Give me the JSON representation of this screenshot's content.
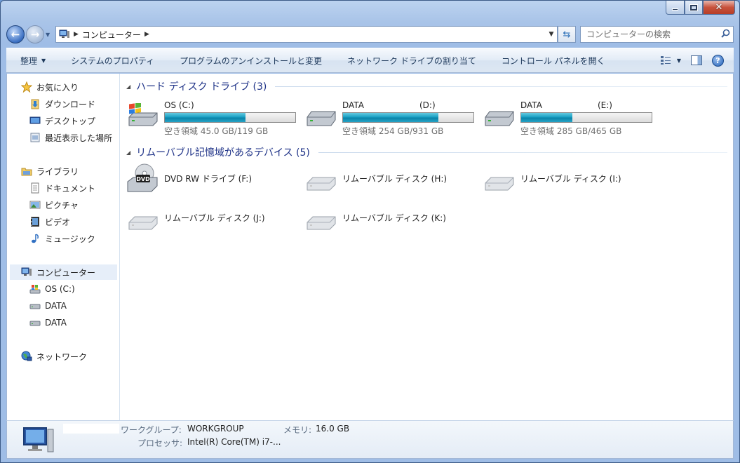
{
  "window": {
    "caption": {
      "minimize": "minimize",
      "maximize": "maximize",
      "close": "✕"
    }
  },
  "nav": {
    "back_icon": "back-arrow-icon",
    "forward_icon": "forward-arrow-icon",
    "address_path": "コンピューター",
    "search_placeholder": "コンピューターの検索"
  },
  "commands": [
    {
      "label": "整理",
      "dropdown": true
    },
    {
      "label": "システムのプロパティ"
    },
    {
      "label": "プログラムのアンインストールと変更"
    },
    {
      "label": "ネットワーク ドライブの割り当て"
    },
    {
      "label": "コントロール パネルを開く"
    }
  ],
  "sidebar": {
    "favorites": {
      "label": "お気に入り",
      "items": [
        "ダウンロード",
        "デスクトップ",
        "最近表示した場所"
      ]
    },
    "libraries": {
      "label": "ライブラリ",
      "items": [
        "ドキュメント",
        "ピクチャ",
        "ビデオ",
        "ミュージック"
      ]
    },
    "computer": {
      "label": "コンピューター",
      "items": [
        "OS (C:)",
        "DATA",
        "DATA"
      ]
    },
    "network": {
      "label": "ネットワーク"
    }
  },
  "groups": {
    "hdd": {
      "title": "ハード ディスク ドライブ (3)"
    },
    "removable": {
      "title": "リムーバブル記憶域があるデバイス (5)"
    }
  },
  "hard_drives": [
    {
      "name": "OS (C:)",
      "letter": "",
      "free": "空き領域 45.0 GB/119 GB",
      "used_fraction": 0.62
    },
    {
      "name": "DATA",
      "letter": "(D:)",
      "free": "空き領域 254 GB/931 GB",
      "used_fraction": 0.73
    },
    {
      "name": "DATA",
      "letter": "(E:)",
      "free": "空き領域 285 GB/465 GB",
      "used_fraction": 0.39
    }
  ],
  "removable_drives": [
    {
      "name": "DVD RW ドライブ (F:)",
      "type": "dvd"
    },
    {
      "name": "リムーバブル ディスク (H:)",
      "type": "removable"
    },
    {
      "name": "リムーバブル ディスク (I:)",
      "type": "removable"
    },
    {
      "name": "リムーバブル ディスク (J:)",
      "type": "removable"
    },
    {
      "name": "リムーバブル ディスク (K:)",
      "type": "removable"
    }
  ],
  "details": {
    "workgroup_label": "ワークグループ:",
    "workgroup_value": "WORKGROUP",
    "memory_label": "メモリ:",
    "memory_value": "16.0 GB",
    "processor_label": "プロセッサ:",
    "processor_value": "Intel(R) Core(TM) i7-..."
  },
  "colors": {
    "accent": "#1e3287",
    "bar_fill": "#1aa0c4",
    "selection": "#e6eef9"
  }
}
